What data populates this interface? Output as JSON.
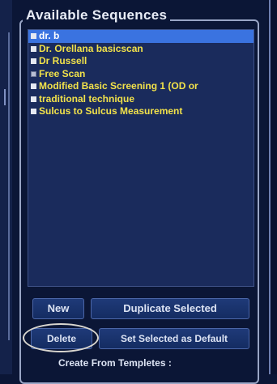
{
  "panel": {
    "title": "Available Sequences"
  },
  "sequences": [
    {
      "label": "dr. b",
      "selected": true,
      "checked": false
    },
    {
      "label": "Dr. Orellana basicscan",
      "selected": false,
      "checked": false
    },
    {
      "label": "Dr Russell",
      "selected": false,
      "checked": false
    },
    {
      "label": "Free Scan",
      "selected": false,
      "checked": true
    },
    {
      "label": "Modified Basic Screening 1 (OD or",
      "selected": false,
      "checked": false
    },
    {
      "label": "traditional technique",
      "selected": false,
      "checked": false
    },
    {
      "label": "Sulcus to Sulcus Measurement",
      "selected": false,
      "checked": false
    }
  ],
  "buttons": {
    "new": "New",
    "duplicate": "Duplicate Selected",
    "delete": "Delete",
    "set_default": "Set Selected as Default"
  },
  "templates": {
    "label": "Create From Templetes :"
  },
  "colors": {
    "background": "#0b1636",
    "list_background": "#1a2b5c",
    "item_text": "#f2e24a",
    "selection": "#3a73e0"
  }
}
